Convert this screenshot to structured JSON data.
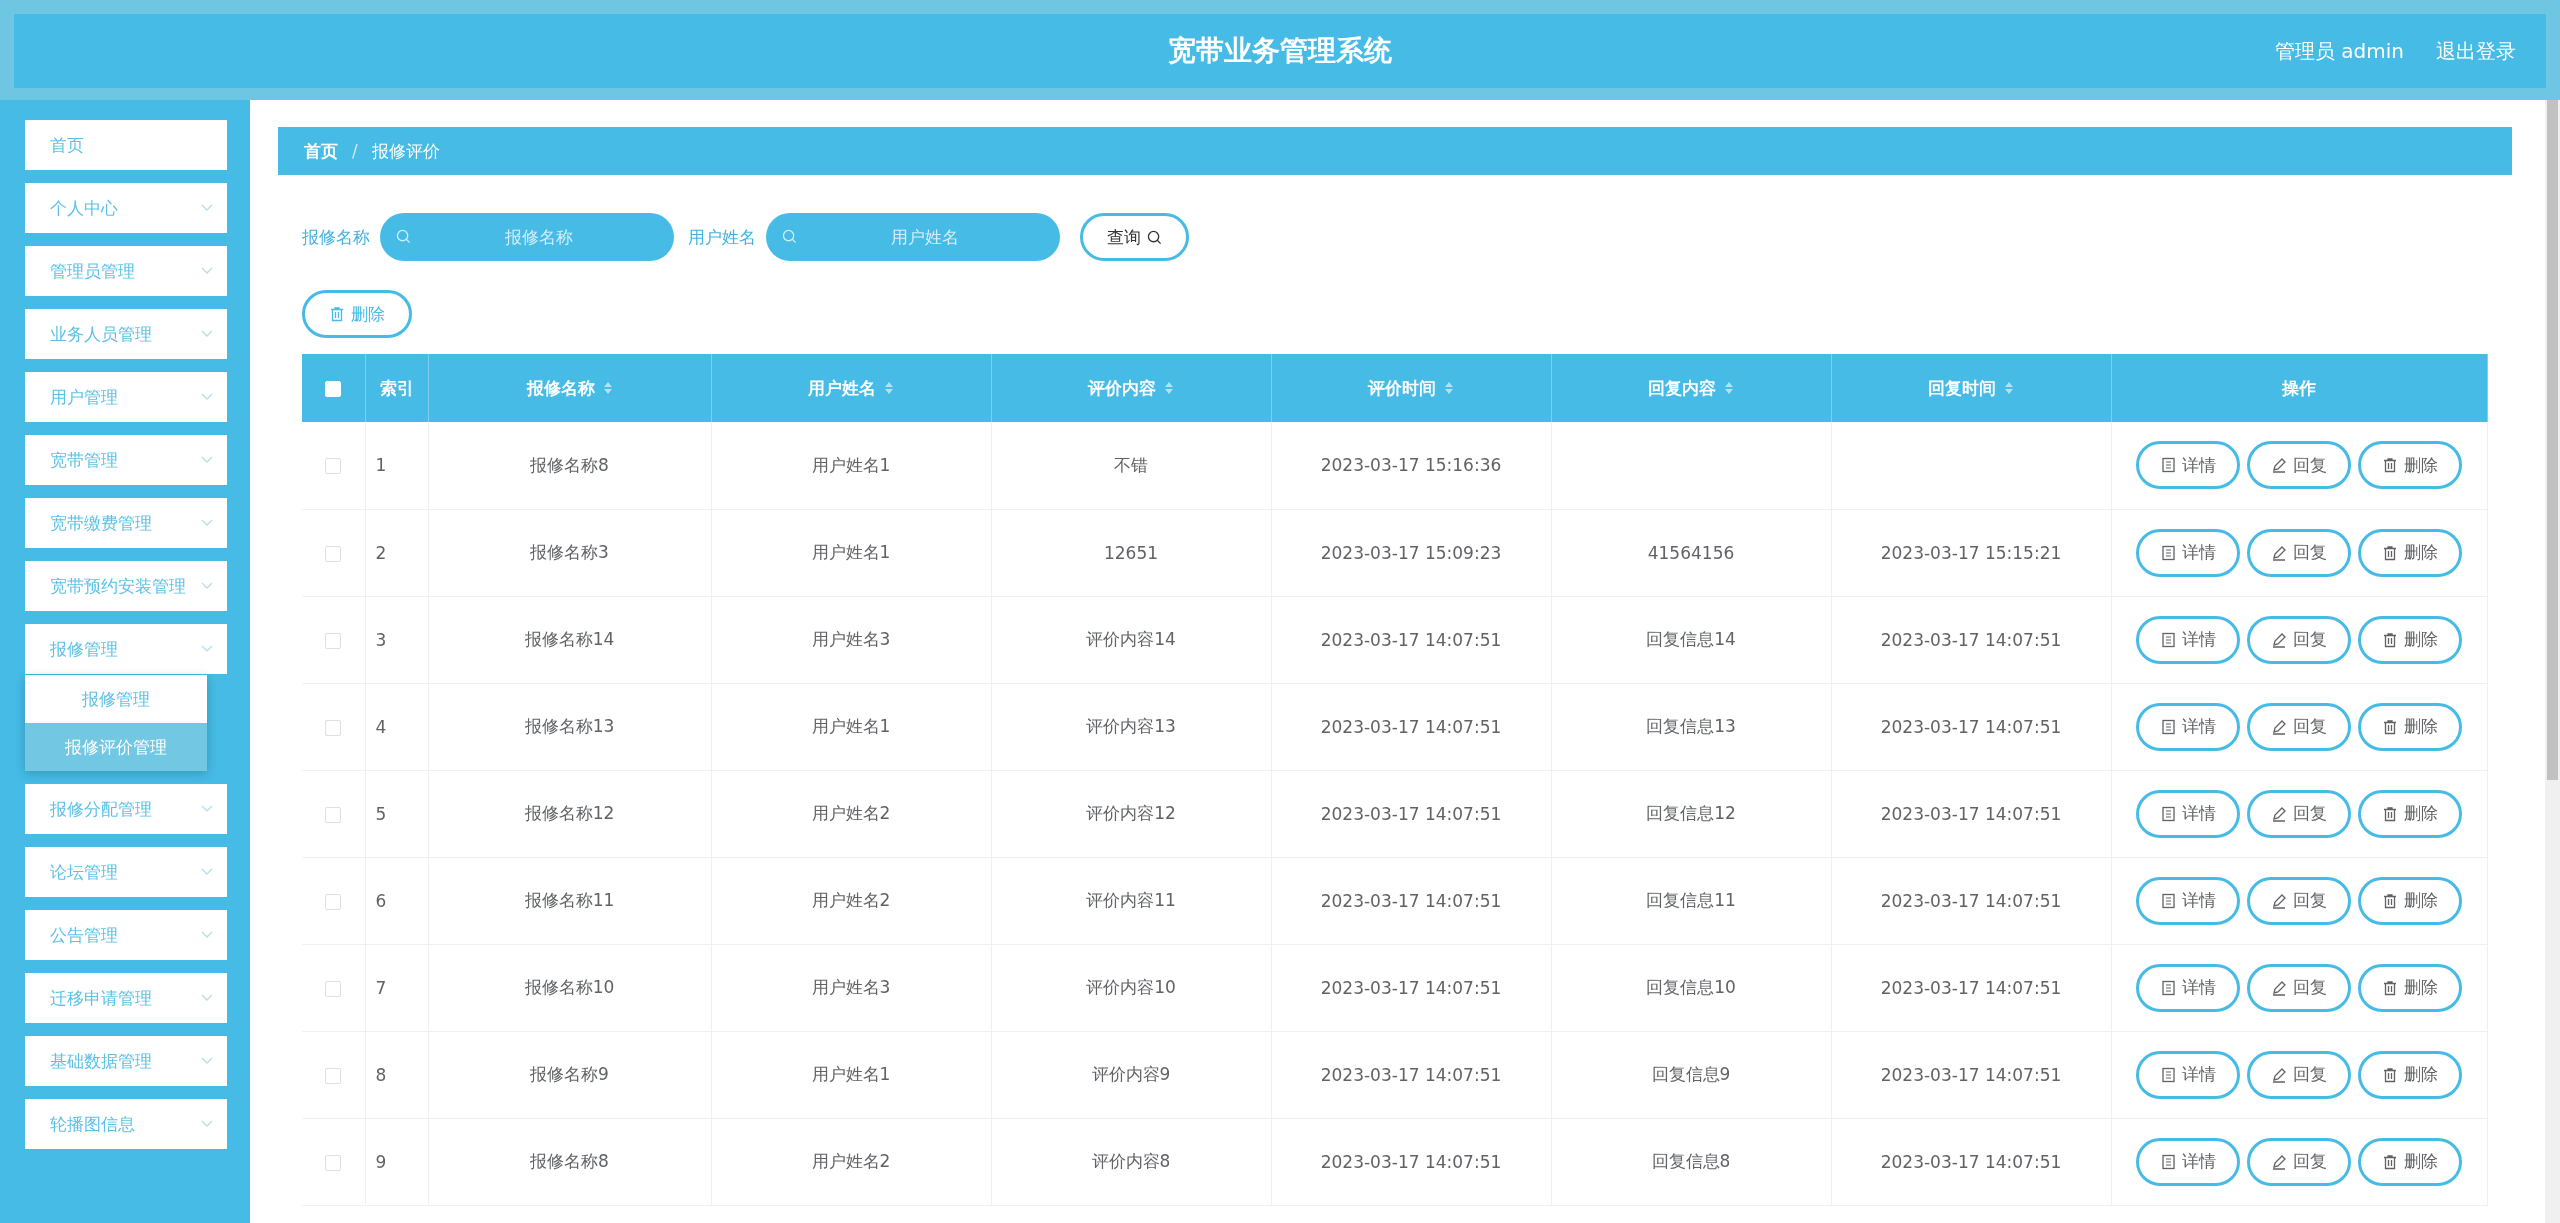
{
  "header": {
    "title": "宽带业务管理系统",
    "user": "管理员 admin",
    "logout": "退出登录"
  },
  "sidebar": {
    "items": [
      {
        "label": "首页",
        "kind": "link"
      },
      {
        "label": "个人中心",
        "kind": "menu"
      },
      {
        "label": "管理员管理",
        "kind": "menu"
      },
      {
        "label": "业务人员管理",
        "kind": "menu"
      },
      {
        "label": "用户管理",
        "kind": "menu"
      },
      {
        "label": "宽带管理",
        "kind": "menu"
      },
      {
        "label": "宽带缴费管理",
        "kind": "menu"
      },
      {
        "label": "宽带预约安装管理",
        "kind": "menu"
      },
      {
        "label": "报修管理",
        "kind": "menu",
        "children": [
          {
            "label": "报修管理",
            "selected": false
          },
          {
            "label": "报修评价管理",
            "selected": true
          }
        ]
      },
      {
        "label": "报修分配管理",
        "kind": "menu"
      },
      {
        "label": "论坛管理",
        "kind": "menu"
      },
      {
        "label": "公告管理",
        "kind": "menu"
      },
      {
        "label": "迁移申请管理",
        "kind": "menu"
      },
      {
        "label": "基础数据管理",
        "kind": "menu"
      },
      {
        "label": "轮播图信息",
        "kind": "menu"
      }
    ]
  },
  "breadcrumb": {
    "separator": "/",
    "items": [
      "首页",
      "报修评价"
    ]
  },
  "search": {
    "fields": [
      {
        "label": "报修名称",
        "placeholder": "报修名称"
      },
      {
        "label": "用户姓名",
        "placeholder": "用户姓名"
      }
    ],
    "button": "查询"
  },
  "toolbar": {
    "delete": "删除"
  },
  "table": {
    "header_checked": false,
    "columns": [
      {
        "label": "索引",
        "sortable": false
      },
      {
        "label": "报修名称",
        "sortable": true
      },
      {
        "label": "用户姓名",
        "sortable": true
      },
      {
        "label": "评价内容",
        "sortable": true
      },
      {
        "label": "评价时间",
        "sortable": true
      },
      {
        "label": "回复内容",
        "sortable": true
      },
      {
        "label": "回复时间",
        "sortable": true
      },
      {
        "label": "操作",
        "sortable": false
      }
    ],
    "rows": [
      {
        "checked": false,
        "cells": [
          "1",
          "报修名称8",
          "用户姓名1",
          "不错",
          "2023-03-17 15:16:36",
          "",
          ""
        ],
        "actions": [
          "详情",
          "回复",
          "删除"
        ]
      },
      {
        "checked": false,
        "cells": [
          "2",
          "报修名称3",
          "用户姓名1",
          "12651",
          "2023-03-17 15:09:23",
          "41564156",
          "2023-03-17 15:15:21"
        ],
        "actions": [
          "详情",
          "回复",
          "删除"
        ]
      },
      {
        "checked": false,
        "cells": [
          "3",
          "报修名称14",
          "用户姓名3",
          "评价内容14",
          "2023-03-17 14:07:51",
          "回复信息14",
          "2023-03-17 14:07:51"
        ],
        "actions": [
          "详情",
          "回复",
          "删除"
        ]
      },
      {
        "checked": false,
        "cells": [
          "4",
          "报修名称13",
          "用户姓名1",
          "评价内容13",
          "2023-03-17 14:07:51",
          "回复信息13",
          "2023-03-17 14:07:51"
        ],
        "actions": [
          "详情",
          "回复",
          "删除"
        ]
      },
      {
        "checked": false,
        "cells": [
          "5",
          "报修名称12",
          "用户姓名2",
          "评价内容12",
          "2023-03-17 14:07:51",
          "回复信息12",
          "2023-03-17 14:07:51"
        ],
        "actions": [
          "详情",
          "回复",
          "删除"
        ]
      },
      {
        "checked": false,
        "cells": [
          "6",
          "报修名称11",
          "用户姓名2",
          "评价内容11",
          "2023-03-17 14:07:51",
          "回复信息11",
          "2023-03-17 14:07:51"
        ],
        "actions": [
          "详情",
          "回复",
          "删除"
        ]
      },
      {
        "checked": false,
        "cells": [
          "7",
          "报修名称10",
          "用户姓名3",
          "评价内容10",
          "2023-03-17 14:07:51",
          "回复信息10",
          "2023-03-17 14:07:51"
        ],
        "actions": [
          "详情",
          "回复",
          "删除"
        ]
      },
      {
        "checked": false,
        "cells": [
          "8",
          "报修名称9",
          "用户姓名1",
          "评价内容9",
          "2023-03-17 14:07:51",
          "回复信息9",
          "2023-03-17 14:07:51"
        ],
        "actions": [
          "详情",
          "回复",
          "删除"
        ]
      },
      {
        "checked": false,
        "cells": [
          "9",
          "报修名称8",
          "用户姓名2",
          "评价内容8",
          "2023-03-17 14:07:51",
          "回复信息8",
          "2023-03-17 14:07:51"
        ],
        "actions": [
          "详情",
          "回复",
          "删除"
        ]
      }
    ]
  }
}
